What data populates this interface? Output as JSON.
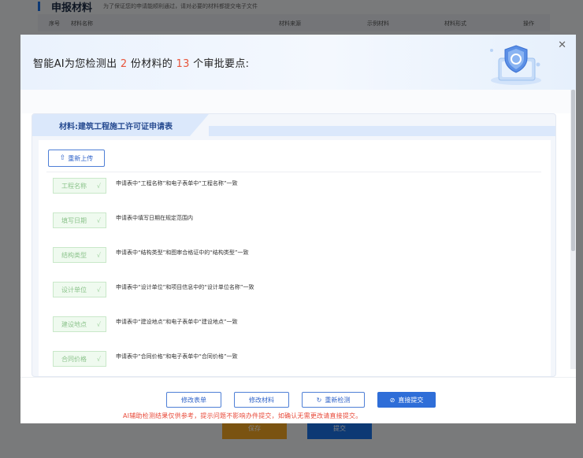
{
  "background": {
    "title": "申报材料",
    "subtitle": "为了保证您的申请能顺利通过，请对必要的材料都提交电子文件",
    "table_headers": [
      "序号",
      "材料名称",
      "材料来源",
      "示例材料",
      "材料形式",
      "操作"
    ],
    "save_label": "保存",
    "submit_label": "提交"
  },
  "modal": {
    "heading_prefix": "智能AI为您检测出",
    "material_count": "2",
    "heading_middle": "份材料的",
    "point_count": "13",
    "heading_suffix": "个审批要点:",
    "close_icon": "close-icon"
  },
  "material": {
    "title": "材料:建筑工程施工许可证申请表",
    "reupload_label": "重新上传",
    "checks": [
      {
        "tag": "工程名称",
        "desc": "申请表中“工程名称”和电子表单中“工程名称”一致"
      },
      {
        "tag": "填写日期",
        "desc": "申请表中填写日期在规定范围内"
      },
      {
        "tag": "结构类型",
        "desc": "申请表中“结构类型”和图审合格证中的“结构类型”一致"
      },
      {
        "tag": "设计单位",
        "desc": "申请表中“设计单位”和项目信息中的“设计单位名称”一致"
      },
      {
        "tag": "建设地点",
        "desc": "申请表中“建设地点”和电子表单中“建设地点”一致"
      },
      {
        "tag": "合同价格",
        "desc": "申请表中“合同价格”和电子表单中“合同价格”一致"
      }
    ]
  },
  "footer": {
    "modify_form": "修改表单",
    "modify_material": "修改材料",
    "recheck": "重新检测",
    "direct_submit": "直接提交",
    "note": "AI辅助检测结果仅供参考，提示问题不影响办件提交，如确认无需更改请直接提交。"
  },
  "colors": {
    "accent": "#2f6ed8",
    "highlight": "#e8553b",
    "pass_green": "#8dc48d",
    "warning_text": "#e84a3a"
  }
}
